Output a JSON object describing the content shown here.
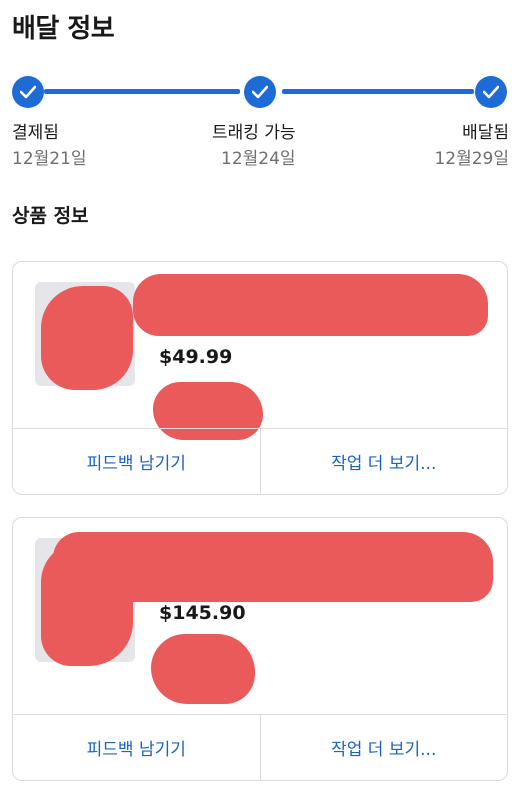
{
  "page": {
    "title": "배달 정보"
  },
  "tracker": {
    "steps": [
      {
        "label": "결제됨",
        "date": "12월21일"
      },
      {
        "label": "트래킹 가능",
        "date": "12월24일"
      },
      {
        "label": "배달됨",
        "date": "12월29일"
      }
    ]
  },
  "items_section": {
    "title": "상품 정보"
  },
  "items": [
    {
      "price": "$49.99",
      "actions": {
        "feedback": "피드백 남기기",
        "more": "작업 더 보기..."
      }
    },
    {
      "price": "$145.90",
      "actions": {
        "feedback": "피드백 남기기",
        "more": "작업 더 보기..."
      }
    }
  ],
  "colors": {
    "accent": "#1f6bd6",
    "link": "#1a63c7",
    "redaction": "#eb5a5a"
  }
}
